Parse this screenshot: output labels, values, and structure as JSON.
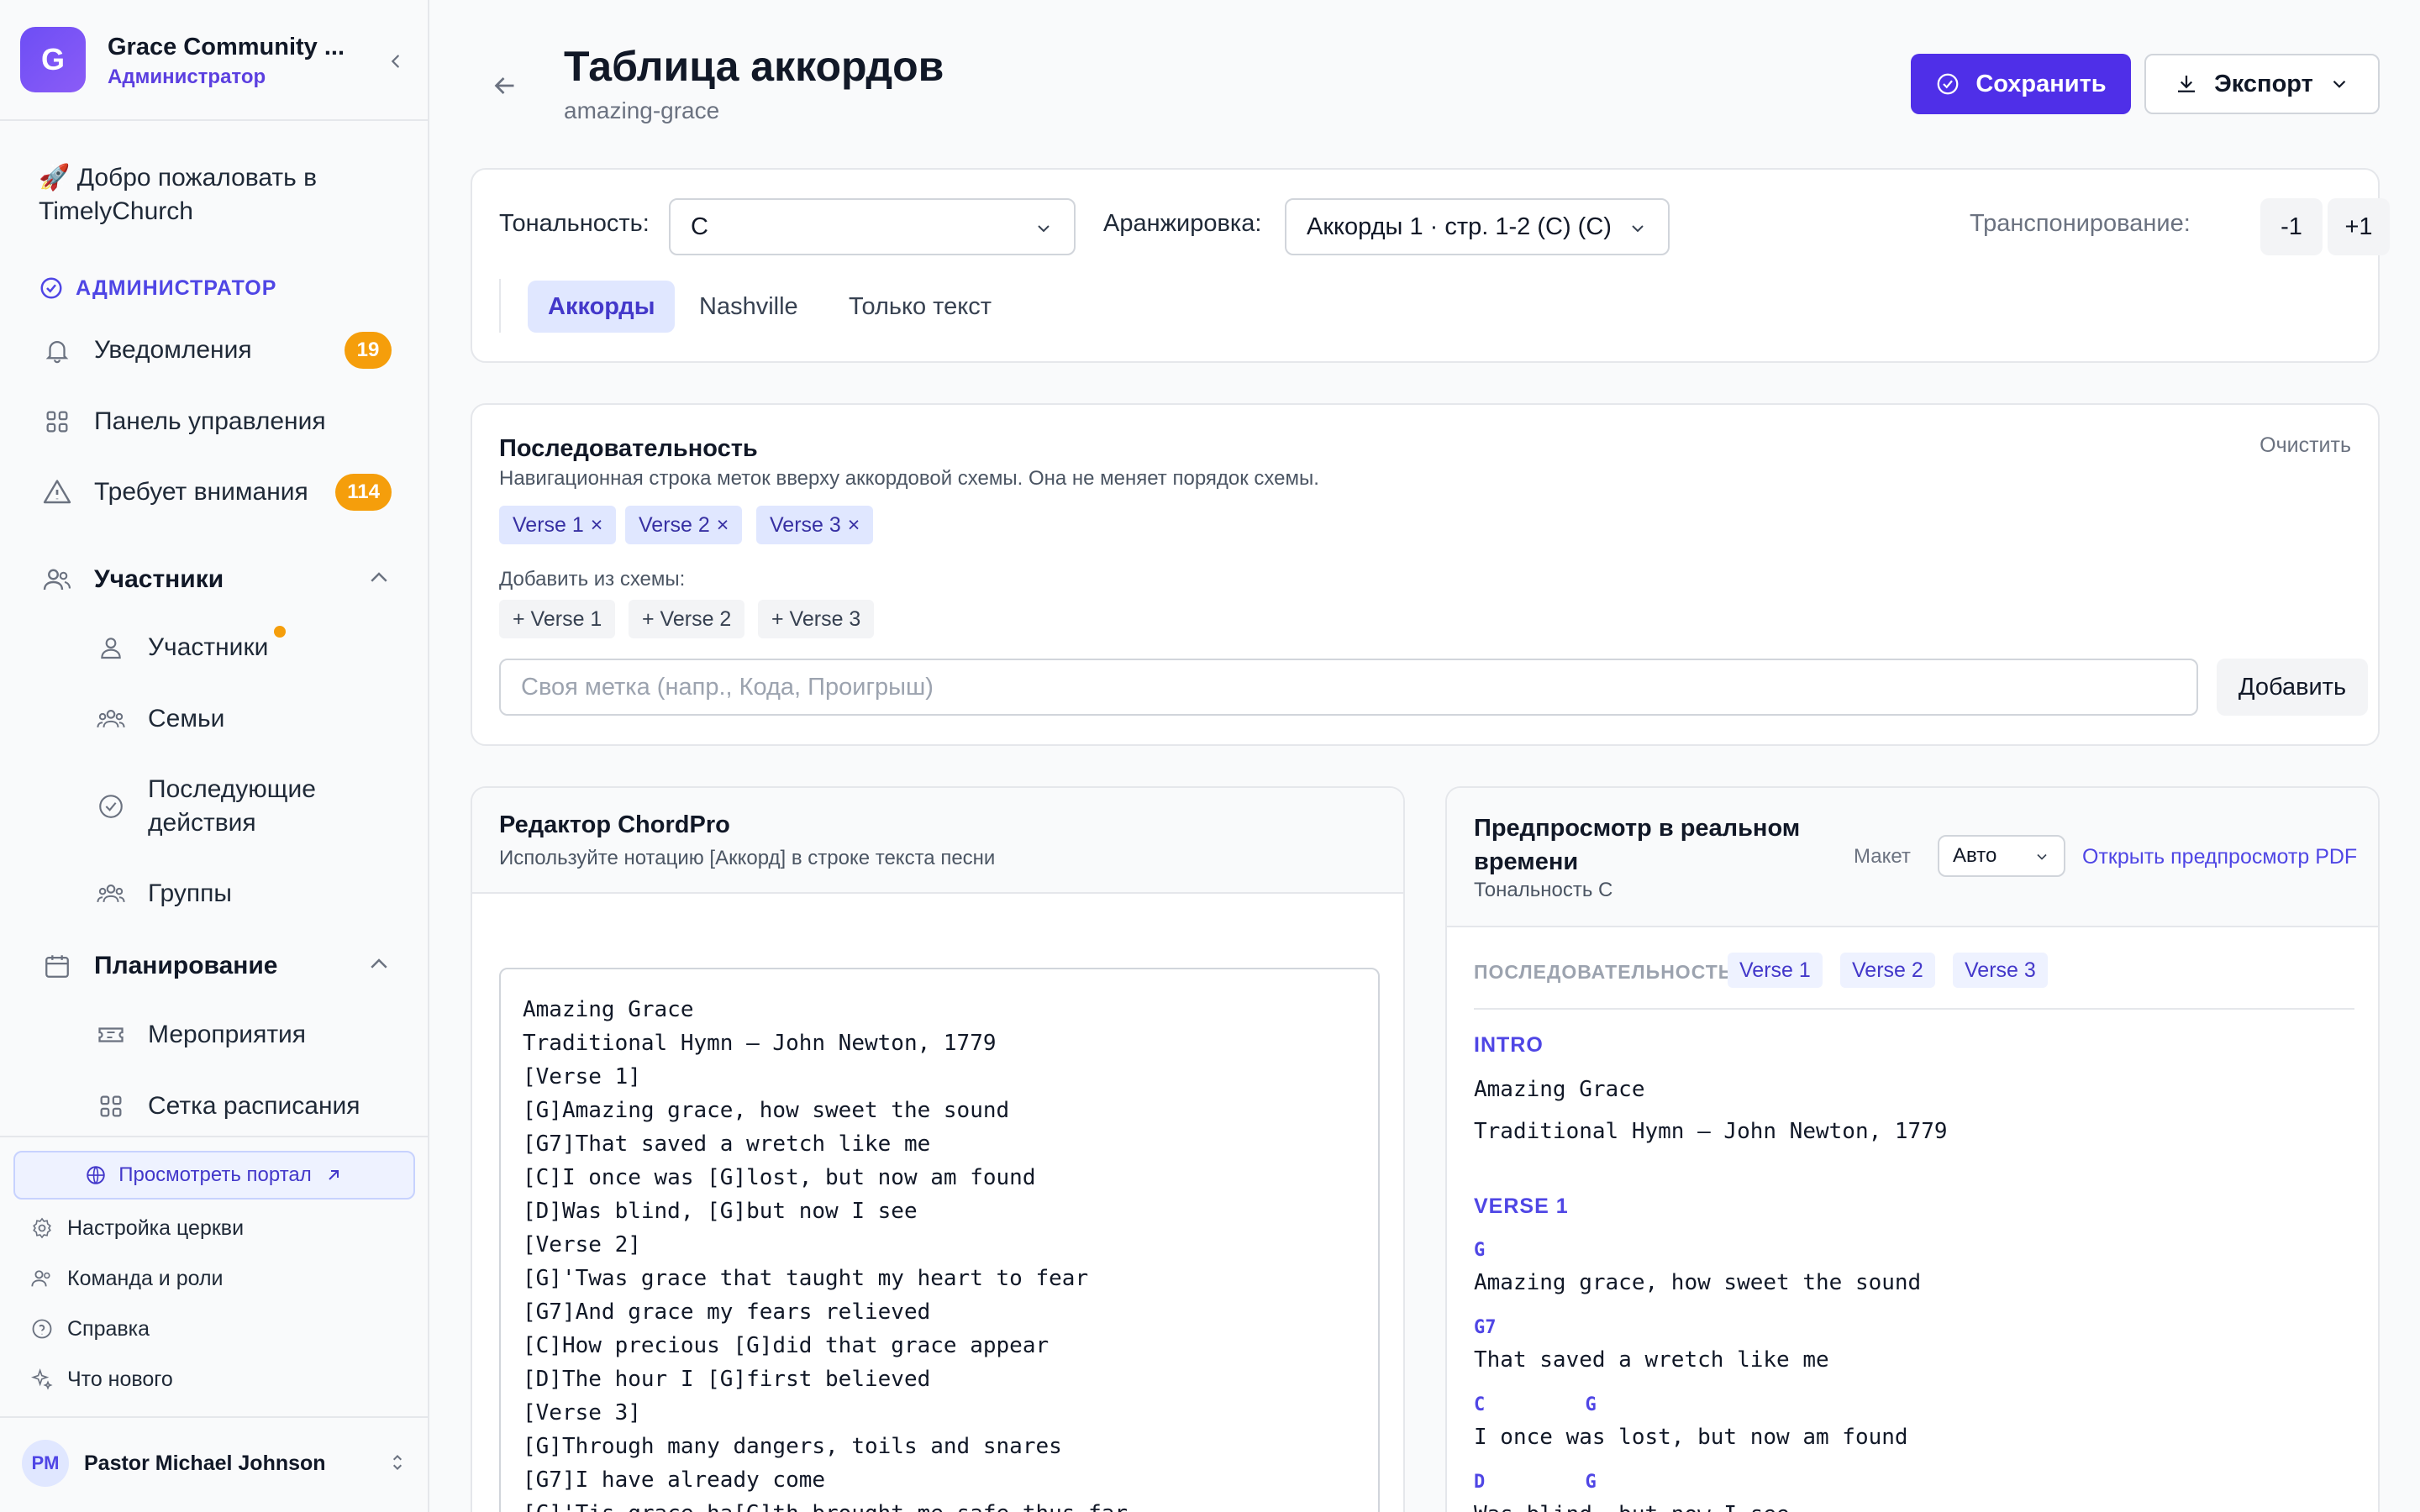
{
  "sidebar": {
    "org_initial": "G",
    "org_name": "Grace Community ...",
    "org_role": "Администратор",
    "welcome": "🚀 Добро пожаловать в TimelyChurch",
    "admin_label": "АДМИНИСТРАТОР",
    "notifications": {
      "label": "Уведомления",
      "badge": "19"
    },
    "dashboard": "Панель управления",
    "attention": {
      "label": "Требует внимания",
      "badge": "114"
    },
    "members_group": "Участники",
    "members_items": [
      "Участники",
      "Семьи",
      "Последующие действия",
      "Группы"
    ],
    "planning_group": "Планирование",
    "planning_items": [
      "Мероприятия",
      "Сетка расписания"
    ],
    "portal_button": "Просмотреть портал",
    "footer_items": [
      "Настройка церкви",
      "Команда и роли",
      "Справка",
      "Что нового"
    ],
    "user_initials": "PM",
    "user_name": "Pastor Michael Johnson"
  },
  "header": {
    "title": "Таблица аккордов",
    "subtitle": "amazing-grace",
    "save_label": "Сохранить",
    "export_label": "Экспорт"
  },
  "controls": {
    "key_label": "Тональность:",
    "key_value": "C",
    "arrangement_label": "Аранжировка:",
    "arrangement_value": "Аккорды 1 · стр. 1-2 (C) (C)",
    "transpose_label": "Транспонирование:",
    "transpose_down": "-1",
    "transpose_up": "+1",
    "tabs": [
      "Аккорды",
      "Nashville",
      "Только текст"
    ],
    "active_tab": "Аккорды"
  },
  "sequence": {
    "title": "Последовательность",
    "description": "Навигационная строка меток вверху аккордовой схемы. Она не меняет порядок схемы.",
    "clear_label": "Очистить",
    "chips": [
      "Verse 1",
      "Verse 2",
      "Verse 3"
    ],
    "remove_glyph": "×",
    "add_from_label": "Добавить из схемы:",
    "add_chips": [
      "+ Verse 1",
      "+ Verse 2",
      "+ Verse 3"
    ],
    "custom_placeholder": "Своя метка (напр., Кода, Проигрыш)",
    "add_button": "Добавить"
  },
  "editor": {
    "title": "Редактор ChordPro",
    "description": "Используйте нотацию [Аккорд] в строке текста песни",
    "lines": [
      "Amazing Grace",
      "Traditional Hymn — John Newton, 1779",
      "[Verse 1]",
      "[G]Amazing grace, how sweet the sound",
      "[G7]That saved a wretch like me",
      "[C]I once was [G]lost, but now am found",
      "[D]Was blind, [G]but now I see",
      "[Verse 2]",
      "[G]'Twas grace that taught my heart to fear",
      "[G7]And grace my fears relieved",
      "[C]How precious [G]did that grace appear",
      "[D]The hour I [G]first believed",
      "[Verse 3]",
      "[G]Through many dangers, toils and snares",
      "[G7]I have already come",
      "[C]'Tis grace ha[G]th brought me safe thus far"
    ]
  },
  "preview": {
    "title": "Предпросмотр в реальном времени",
    "key_note": "Тональность C",
    "layout_label": "Макет",
    "layout_value": "Авто",
    "open_pdf": "Открыть предпросмотр PDF",
    "sequence_label": "ПОСЛЕДОВАТЕЛЬНОСТЬ",
    "sequence_chips": [
      "Verse 1",
      "Verse 2",
      "Verse 3"
    ],
    "intro_label": "INTRO",
    "intro_lines": [
      "Amazing Grace",
      "Traditional Hymn — John Newton, 1779"
    ],
    "verse1_label": "VERSE 1",
    "verse1": [
      {
        "chords": "G",
        "lyric": "Amazing grace, how sweet the sound"
      },
      {
        "chords": "G7",
        "lyric": "That saved a wretch like me"
      },
      {
        "chords": "C         G",
        "lyric": "I once was lost, but now am found"
      },
      {
        "chords": "D         G",
        "lyric": "Was blind, but now I see"
      }
    ]
  },
  "colors": {
    "accent": "#4f2fe8",
    "badge": "#f59e0b",
    "chip_bg": "#e0e7ff"
  }
}
